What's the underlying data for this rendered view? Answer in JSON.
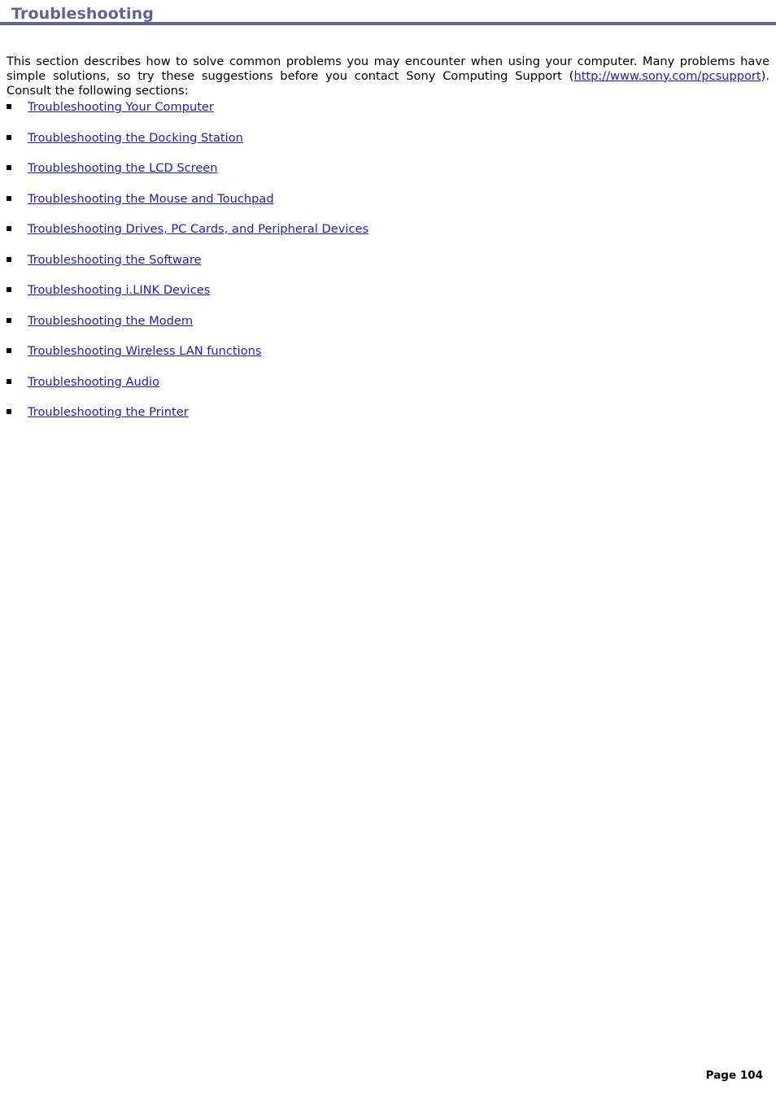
{
  "page": {
    "heading": "Troubleshooting",
    "accent_color": "#62629b",
    "link_color": "#1a1ad0",
    "text_color": "#000000",
    "background_color": "#ffffff"
  },
  "intro": {
    "part1": "This section describes how to solve common problems you may encounter when using your computer. Many problems have simple solutions, so try these suggestions before you contact Sony Computing Support (",
    "url_text": "http://www.sony.com/pcsupport",
    "url_href": "http://www.sony.com/pcsupport",
    "part2": "). Consult the following sections:"
  },
  "sections": [
    {
      "label": "Troubleshooting Your Computer"
    },
    {
      "label": "Troubleshooting the Docking Station"
    },
    {
      "label": "Troubleshooting the LCD Screen"
    },
    {
      "label": "Troubleshooting the Mouse and Touchpad"
    },
    {
      "label": "Troubleshooting Drives, PC Cards, and Peripheral Devices"
    },
    {
      "label": "Troubleshooting the Software"
    },
    {
      "label": "Troubleshooting i.LINK Devices"
    },
    {
      "label": "Troubleshooting the Modem"
    },
    {
      "label": "Troubleshooting Wireless LAN functions"
    },
    {
      "label": "Troubleshooting Audio"
    },
    {
      "label": "Troubleshooting the Printer"
    }
  ],
  "footer": {
    "page_label": "Page 104"
  }
}
